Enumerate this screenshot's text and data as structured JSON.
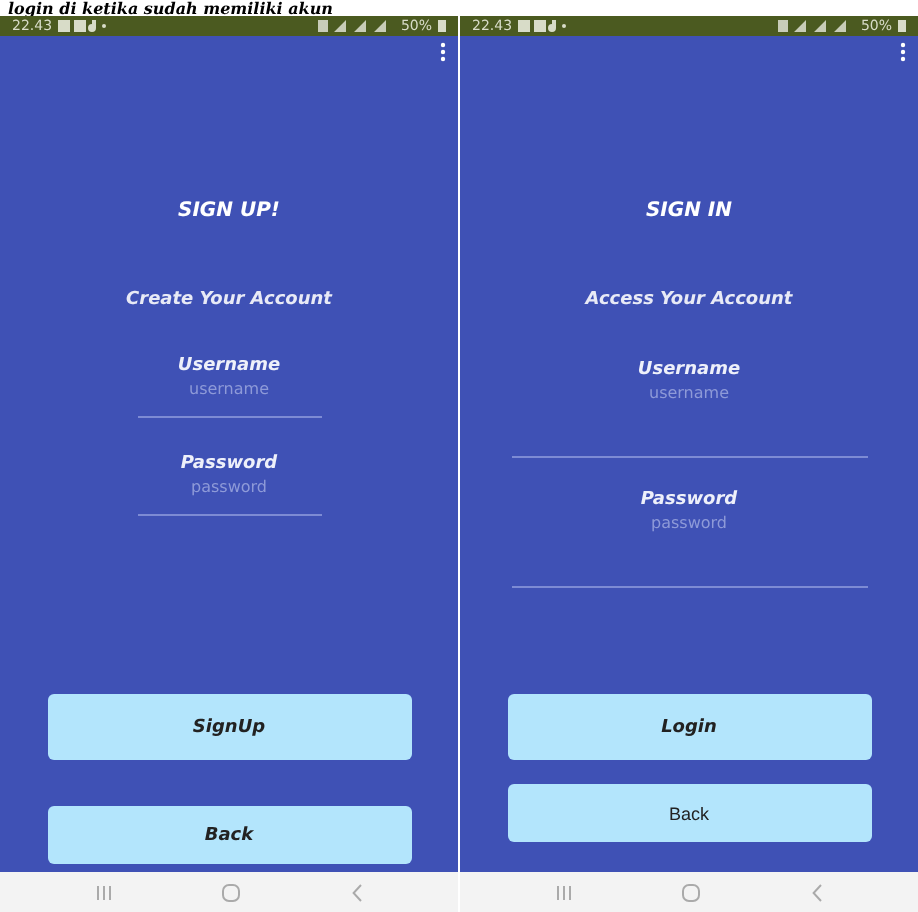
{
  "caption": "login di ketika sudah memiliki akun",
  "screens": [
    {
      "status_bar": {
        "time": "22.43",
        "battery": "50%"
      },
      "title": "SIGN UP!",
      "subtitle": "Create Your Account",
      "fields": [
        {
          "label": "Username",
          "placeholder": "username"
        },
        {
          "label": "Password",
          "placeholder": "password"
        }
      ],
      "buttons": [
        {
          "label": "SignUp",
          "kind": "bold"
        },
        {
          "label": "Back",
          "kind": "bold"
        }
      ]
    },
    {
      "status_bar": {
        "time": "22.43",
        "battery": "50%"
      },
      "title": "SIGN IN",
      "subtitle": "Access Your Account",
      "fields": [
        {
          "label": "Username",
          "placeholder": "username"
        },
        {
          "label": "Password",
          "placeholder": "password"
        }
      ],
      "buttons": [
        {
          "label": "Login",
          "kind": "bold"
        },
        {
          "label": "Back",
          "kind": "plain"
        }
      ]
    }
  ]
}
